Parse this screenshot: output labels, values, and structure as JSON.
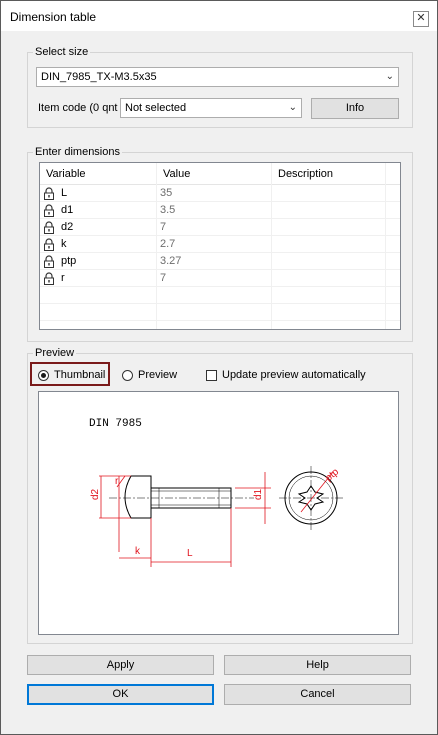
{
  "window": {
    "title": "Dimension table",
    "close_glyph": "✕"
  },
  "select_size": {
    "group_label": "Select size",
    "size_value": "DIN_7985_TX-M3.5x35",
    "item_code_label": "Item code (0 qnt",
    "item_code_value": "Not selected",
    "info_label": "Info"
  },
  "dimensions": {
    "group_label": "Enter dimensions",
    "columns": [
      "Variable",
      "Value",
      "Description"
    ],
    "rows": [
      {
        "variable": "L",
        "value": "35",
        "description": ""
      },
      {
        "variable": "d1",
        "value": "3.5",
        "description": ""
      },
      {
        "variable": "d2",
        "value": "7",
        "description": ""
      },
      {
        "variable": "k",
        "value": "2.7",
        "description": ""
      },
      {
        "variable": "ptp",
        "value": "3.27",
        "description": ""
      },
      {
        "variable": "r",
        "value": "7",
        "description": ""
      }
    ]
  },
  "preview": {
    "group_label": "Preview",
    "thumbnail_label": "Thumbnail",
    "preview_label": "Preview",
    "update_label": "Update preview automatically",
    "thumbnail_selected": true,
    "update_checked": false,
    "drawing": {
      "standard": "DIN 7985",
      "dim_d2": "d2",
      "dim_d1": "d1",
      "dim_r": "r",
      "dim_k": "k",
      "dim_L": "L",
      "dim_ptp": "ptp"
    }
  },
  "buttons": {
    "apply": "Apply",
    "help": "Help",
    "ok": "OK",
    "cancel": "Cancel"
  },
  "colors": {
    "accent": "#0078d7",
    "dimension_red": "#e0141e",
    "highlight": "#7a1a1a"
  }
}
